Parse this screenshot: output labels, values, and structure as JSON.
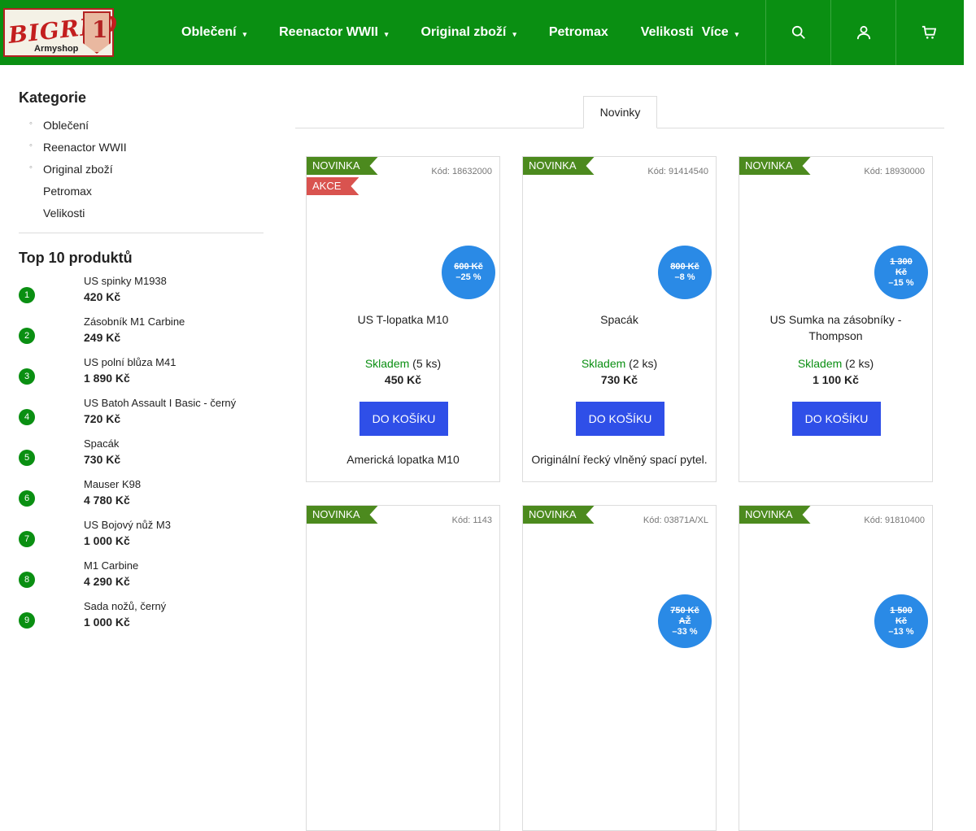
{
  "logo": {
    "word": "BIGRED",
    "sub": "Armyshop",
    "badge": "1"
  },
  "nav": {
    "items": [
      {
        "label": "Oblečení",
        "caret": "▾"
      },
      {
        "label": "Reenactor WWII",
        "caret": "▾"
      },
      {
        "label": "Original zboží",
        "caret": "▾"
      },
      {
        "label": "Petromax",
        "caret": ""
      },
      {
        "label": "Velikosti",
        "caret": ""
      },
      {
        "label": "Více",
        "caret": "▾"
      }
    ],
    "icons": [
      "search-icon",
      "user-icon",
      "cart-icon"
    ]
  },
  "sidebar": {
    "categories_title": "Kategorie",
    "categories": [
      {
        "label": "Oblečení",
        "dot": "◦"
      },
      {
        "label": "Reenactor WWII",
        "dot": "◦"
      },
      {
        "label": "Original zboží",
        "dot": "◦"
      },
      {
        "label": "Petromax",
        "dot": ""
      },
      {
        "label": "Velikosti",
        "dot": ""
      }
    ],
    "top_title": "Top 10 produktů",
    "top": [
      {
        "rank": "1",
        "name": "US spinky M1938",
        "price": "420 Kč"
      },
      {
        "rank": "2",
        "name": "Zásobník M1 Carbine",
        "price": "249 Kč"
      },
      {
        "rank": "3",
        "name": "US polní blůza M41",
        "price": "1 890 Kč"
      },
      {
        "rank": "4",
        "name": "US Batoh Assault I Basic - černý",
        "price": "720 Kč"
      },
      {
        "rank": "5",
        "name": "Spacák",
        "price": "730 Kč"
      },
      {
        "rank": "6",
        "name": "Mauser K98",
        "price": "4 780 Kč"
      },
      {
        "rank": "7",
        "name": "US Bojový nůž M3",
        "price": "1 000 Kč"
      },
      {
        "rank": "8",
        "name": "M1 Carbine",
        "price": "4 290 Kč"
      },
      {
        "rank": "9",
        "name": "Sada nožů, černý",
        "price": "1 000 Kč"
      }
    ]
  },
  "main": {
    "tab": "Novinky",
    "products": [
      {
        "flag_new": "NOVINKA",
        "flag_sale": "AKCE",
        "code": "Kód: 18632000",
        "disc_old": "600 Kč",
        "disc_pct": "–25 %",
        "name": "US T-lopatka M10",
        "stock_label": "Skladem",
        "stock_count": "(5 ks)",
        "price": "450 Kč",
        "button": "DO KOŠÍKU",
        "desc": "Americká lopatka M10"
      },
      {
        "flag_new": "NOVINKA",
        "flag_sale": "",
        "code": "Kód: 91414540",
        "disc_old": "800 Kč",
        "disc_pct": "–8 %",
        "name": "Spacák",
        "stock_label": "Skladem",
        "stock_count": "(2 ks)",
        "price": "730 Kč",
        "button": "DO KOŠÍKU",
        "desc": "Originální řecký vlněný spací pytel."
      },
      {
        "flag_new": "NOVINKA",
        "flag_sale": "",
        "code": "Kód: 18930000",
        "disc_old": "1 300 Kč",
        "disc_pct": "–15 %",
        "name": "US Sumka na zásobníky - Thompson",
        "stock_label": "Skladem",
        "stock_count": "(2 ks)",
        "price": "1 100 Kč",
        "button": "DO KOŠÍKU",
        "desc": ""
      },
      {
        "flag_new": "NOVINKA",
        "flag_sale": "",
        "code": "Kód: 1143",
        "disc_old": "",
        "disc_pct": "",
        "name": "",
        "stock_label": "",
        "stock_count": "",
        "price": "",
        "button": "",
        "desc": ""
      },
      {
        "flag_new": "NOVINKA",
        "flag_sale": "",
        "code": "Kód: 03871A/XL",
        "disc_old": "750 Kč AŽ",
        "disc_pct": "–33 %",
        "name": "",
        "stock_label": "",
        "stock_count": "",
        "price": "",
        "button": "",
        "desc": ""
      },
      {
        "flag_new": "NOVINKA",
        "flag_sale": "",
        "code": "Kód: 91810400",
        "disc_old": "1 500 Kč",
        "disc_pct": "–13 %",
        "name": "",
        "stock_label": "",
        "stock_count": "",
        "price": "",
        "button": "",
        "desc": ""
      }
    ]
  }
}
